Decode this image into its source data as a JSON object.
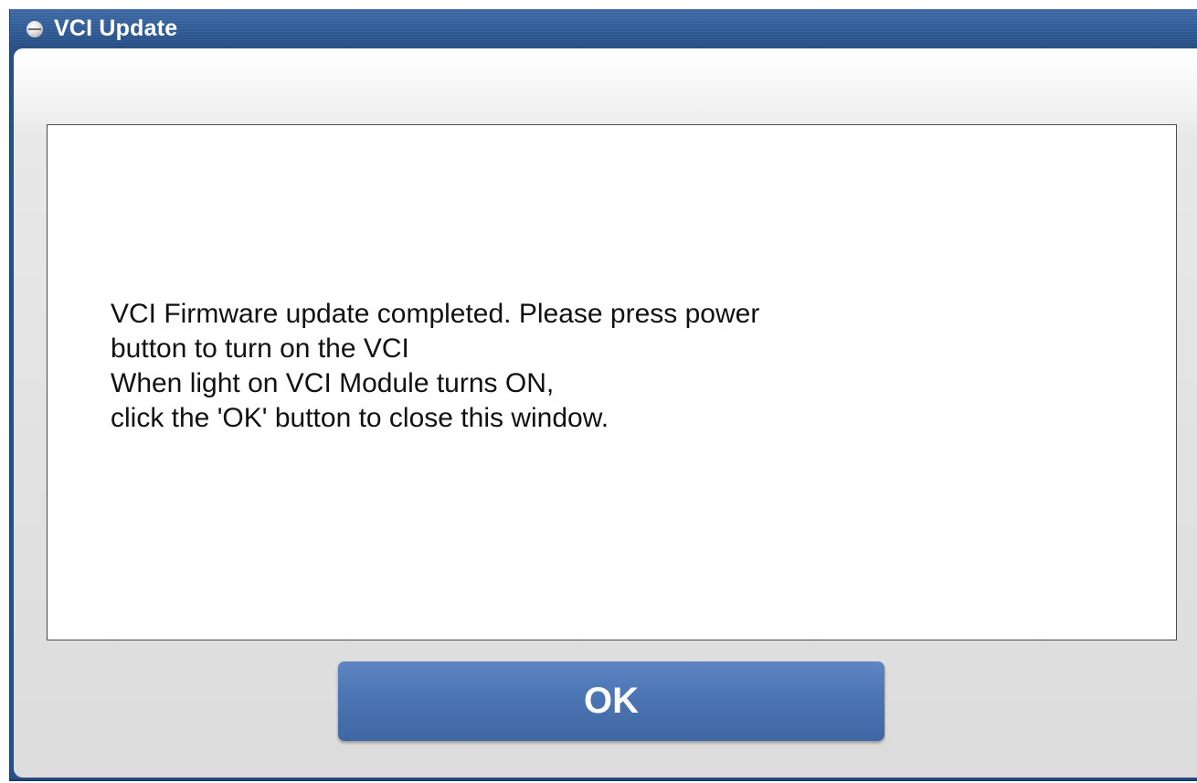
{
  "window": {
    "title": "VCI Update",
    "title_icon": "circle-icon"
  },
  "message": {
    "lines": [
      "VCI Firmware update completed. Please press power",
      "button to turn on the VCI",
      "When light on VCI Module turns ON,",
      "click the 'OK' button to close this window."
    ]
  },
  "buttons": {
    "ok_label": "OK"
  },
  "colors": {
    "titlebar": "#2f5a94",
    "button": "#4d76b4",
    "text": "#111111"
  }
}
